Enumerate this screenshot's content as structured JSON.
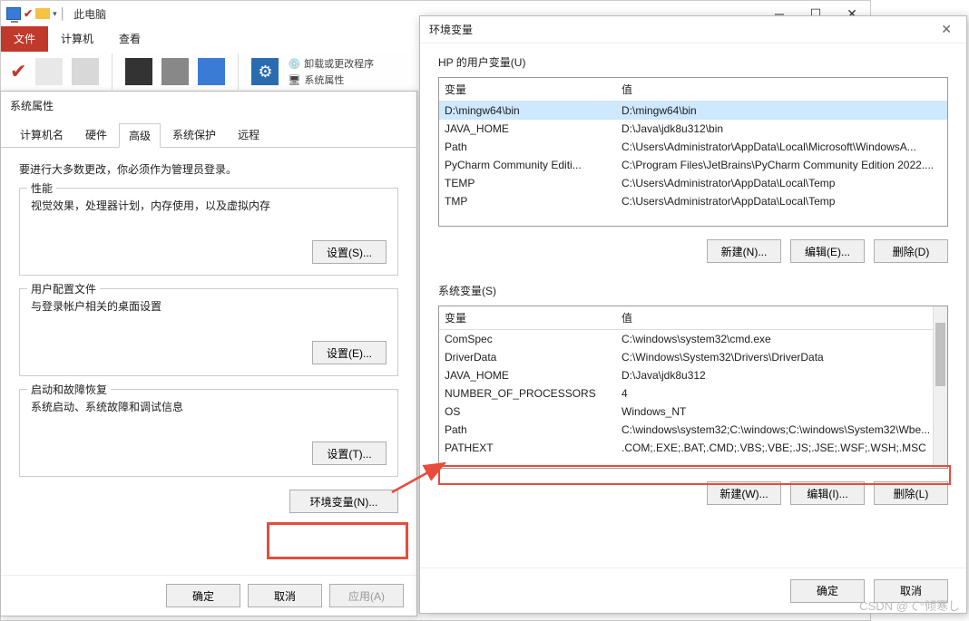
{
  "explorer": {
    "title": "此电脑",
    "tabs": {
      "file": "文件",
      "computer": "计算机",
      "view": "查看"
    },
    "ribbon": {
      "uninstall": "卸载或更改程序",
      "sysprops": "系统属性"
    }
  },
  "sysprops": {
    "title": "系统属性",
    "tabs": {
      "computer_name": "计算机名",
      "hardware": "硬件",
      "advanced": "高级",
      "system_protect": "系统保护",
      "remote": "远程"
    },
    "admin_note": "要进行大多数更改，你必须作为管理员登录。",
    "perf": {
      "legend": "性能",
      "desc": "视觉效果，处理器计划，内存使用，以及虚拟内存",
      "btn": "设置(S)..."
    },
    "profile": {
      "legend": "用户配置文件",
      "desc": "与登录帐户相关的桌面设置",
      "btn": "设置(E)..."
    },
    "startup": {
      "legend": "启动和故障恢复",
      "desc": "系统启动、系统故障和调试信息",
      "btn": "设置(T)..."
    },
    "env_btn": "环境变量(N)...",
    "ok": "确定",
    "cancel": "取消",
    "apply": "应用(A)"
  },
  "envdlg": {
    "title": "环境变量",
    "user_section": "HP 的用户变量(U)",
    "sys_section": "系统变量(S)",
    "col_var": "变量",
    "col_val": "值",
    "user_vars": [
      {
        "name": "D:\\mingw64\\bin",
        "value": "D:\\mingw64\\bin"
      },
      {
        "name": "JAVA_HOME",
        "value": "D:\\Java\\jdk8u312\\bin"
      },
      {
        "name": "Path",
        "value": "C:\\Users\\Administrator\\AppData\\Local\\Microsoft\\WindowsA..."
      },
      {
        "name": "PyCharm Community Editi...",
        "value": "C:\\Program Files\\JetBrains\\PyCharm Community Edition 2022...."
      },
      {
        "name": "TEMP",
        "value": "C:\\Users\\Administrator\\AppData\\Local\\Temp"
      },
      {
        "name": "TMP",
        "value": "C:\\Users\\Administrator\\AppData\\Local\\Temp"
      }
    ],
    "sys_vars": [
      {
        "name": "ComSpec",
        "value": "C:\\windows\\system32\\cmd.exe"
      },
      {
        "name": "DriverData",
        "value": "C:\\Windows\\System32\\Drivers\\DriverData"
      },
      {
        "name": "JAVA_HOME",
        "value": "D:\\Java\\jdk8u312"
      },
      {
        "name": "NUMBER_OF_PROCESSORS",
        "value": "4"
      },
      {
        "name": "OS",
        "value": "Windows_NT"
      },
      {
        "name": "Path",
        "value": "C:\\windows\\system32;C:\\windows;C:\\windows\\System32\\Wbe..."
      },
      {
        "name": "PATHEXT",
        "value": ".COM;.EXE;.BAT;.CMD;.VBS;.VBE;.JS;.JSE;.WSF;.WSH;.MSC"
      }
    ],
    "btn_new_n": "新建(N)...",
    "btn_edit_e": "编辑(E)...",
    "btn_del_d": "删除(D)",
    "btn_new_w": "新建(W)...",
    "btn_edit_i": "编辑(I)...",
    "btn_del_l": "删除(L)",
    "ok": "确定",
    "cancel": "取消"
  },
  "watermark": "CSDN @て°倾寒し"
}
